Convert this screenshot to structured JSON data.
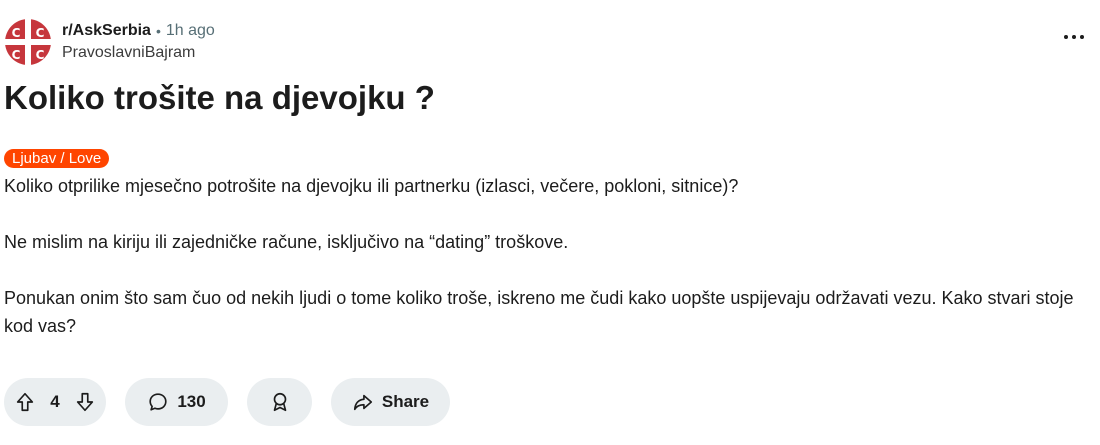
{
  "post": {
    "subreddit": "r/AskSerbia",
    "separator": "•",
    "time": "1h ago",
    "username": "PravoslavniBajram",
    "title": "Koliko trošite na djevojku ?",
    "flair": "Ljubav / Love",
    "flair_color": "#ff4500",
    "paragraphs": [
      "Koliko otprilike mjesečno potrošite na djevojku ili partnerku (izlasci, večere, pokloni, sitnice)?",
      "Ne mislim na kiriju ili zajedničke račune, isključivo na “dating” troškove.",
      "Ponukan onim što sam čuo od nekih ljudi o tome koliko troše, iskreno me čudi kako uopšte uspijevaju održavati vezu. Kako stvari stoje kod vas?"
    ]
  },
  "actions": {
    "votes": "4",
    "comments": "130",
    "share_label": "Share"
  },
  "icons": {
    "avatar": "serbian-cross-emblem",
    "more": "more-horizontal-icon",
    "upvote": "arrow-up-outline-icon",
    "downvote": "arrow-down-outline-icon",
    "comment": "speech-bubble-icon",
    "award": "award-ribbon-icon",
    "share": "share-arrow-icon"
  }
}
